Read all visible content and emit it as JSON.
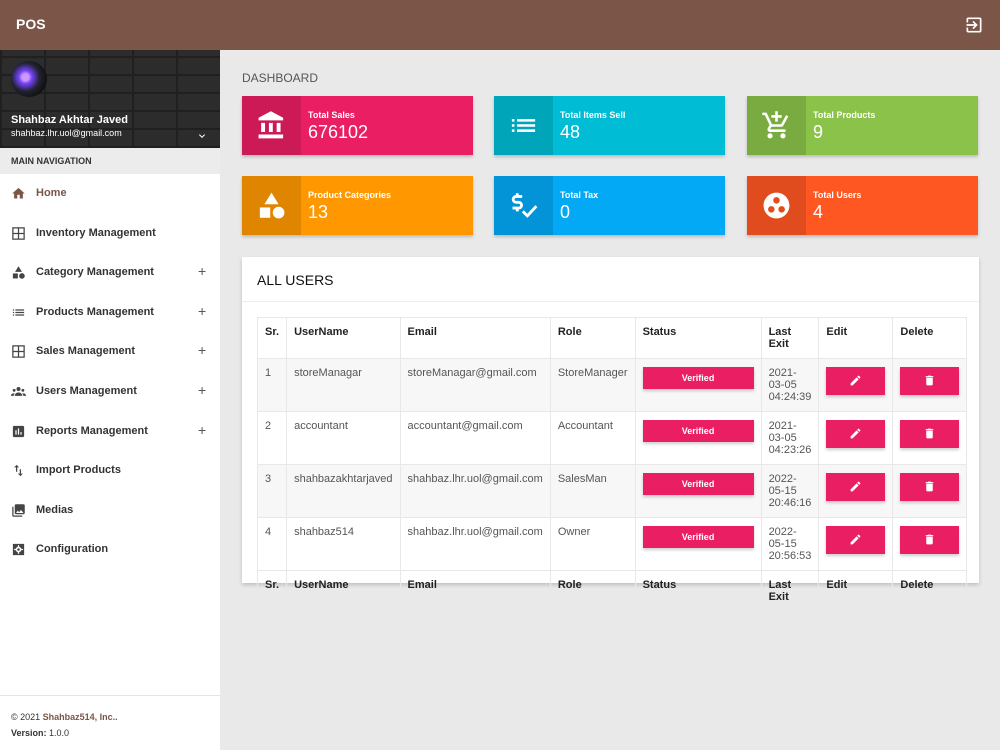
{
  "app": {
    "title": "POS"
  },
  "user": {
    "name": "Shahbaz Akhtar Javed",
    "email": "shahbaz.lhr.uol@gmail.com"
  },
  "nav": {
    "header": "MAIN NAVIGATION",
    "items": [
      {
        "label": "Home",
        "icon": "home-icon",
        "expandable": false,
        "active": true
      },
      {
        "label": "Inventory Management",
        "icon": "grid-icon",
        "expandable": false
      },
      {
        "label": "Category Management",
        "icon": "shapes-icon",
        "expandable": true
      },
      {
        "label": "Products Management",
        "icon": "list-icon",
        "expandable": true
      },
      {
        "label": "Sales Management",
        "icon": "grid-icon",
        "expandable": true
      },
      {
        "label": "Users Management",
        "icon": "users-icon",
        "expandable": true
      },
      {
        "label": "Reports Management",
        "icon": "report-icon",
        "expandable": true
      },
      {
        "label": "Import Products",
        "icon": "import-icon",
        "expandable": false
      },
      {
        "label": "Medias",
        "icon": "image-icon",
        "expandable": false
      },
      {
        "label": "Configuration",
        "icon": "settings-icon",
        "expandable": false
      }
    ],
    "plus_symbol": "+"
  },
  "legal": {
    "copyright": "© 2021 ",
    "brand": "Shahbaz514, Inc..",
    "version_label": "Version:",
    "version": " 1.0.0"
  },
  "page": {
    "title": "DASHBOARD"
  },
  "stats": [
    {
      "label": "Total Sales",
      "value": "676102",
      "color": "#e91e63",
      "icon": "bank-icon"
    },
    {
      "label": "Total Items Sell",
      "value": "48",
      "color": "#00bcd4",
      "icon": "list-icon"
    },
    {
      "label": "Total Products",
      "value": "9",
      "color": "#8bc34a",
      "icon": "cart-icon"
    },
    {
      "label": "Product Categories",
      "value": "13",
      "color": "#ff9800",
      "icon": "shapes-icon"
    },
    {
      "label": "Total Tax",
      "value": "0",
      "color": "#03a9f4",
      "icon": "dollar-check-icon"
    },
    {
      "label": "Total Users",
      "value": "4",
      "color": "#ff5722",
      "icon": "group-icon"
    }
  ],
  "users_card": {
    "title": "ALL USERS",
    "columns": [
      "Sr.",
      "UserName",
      "Email",
      "Role",
      "Status",
      "Last Exit",
      "Edit",
      "Delete"
    ],
    "rows": [
      {
        "sr": "1",
        "username": "storeManagar",
        "email": "storeManagar@gmail.com",
        "role": "StoreManager",
        "status": "Verified",
        "last_exit_date": "2021-03-05",
        "last_exit_time": "04:24:39"
      },
      {
        "sr": "2",
        "username": "accountant",
        "email": "accountant@gmail.com",
        "role": "Accountant",
        "status": "Verified",
        "last_exit_date": "2021-03-05",
        "last_exit_time": "04:23:26"
      },
      {
        "sr": "3",
        "username": "shahbazakhtarjaved",
        "email": "shahbaz.lhr.uol@gmail.com",
        "role": "SalesMan",
        "status": "Verified",
        "last_exit_date": "2022-05-15",
        "last_exit_time": "20:46:16"
      },
      {
        "sr": "4",
        "username": "shahbaz514",
        "email": "shahbaz.lhr.uol@gmail.com",
        "role": "Owner",
        "status": "Verified",
        "last_exit_date": "2022-05-15",
        "last_exit_time": "20:56:53"
      }
    ]
  },
  "colors": {
    "brand": "#7a5548",
    "accent": "#e91e63"
  }
}
